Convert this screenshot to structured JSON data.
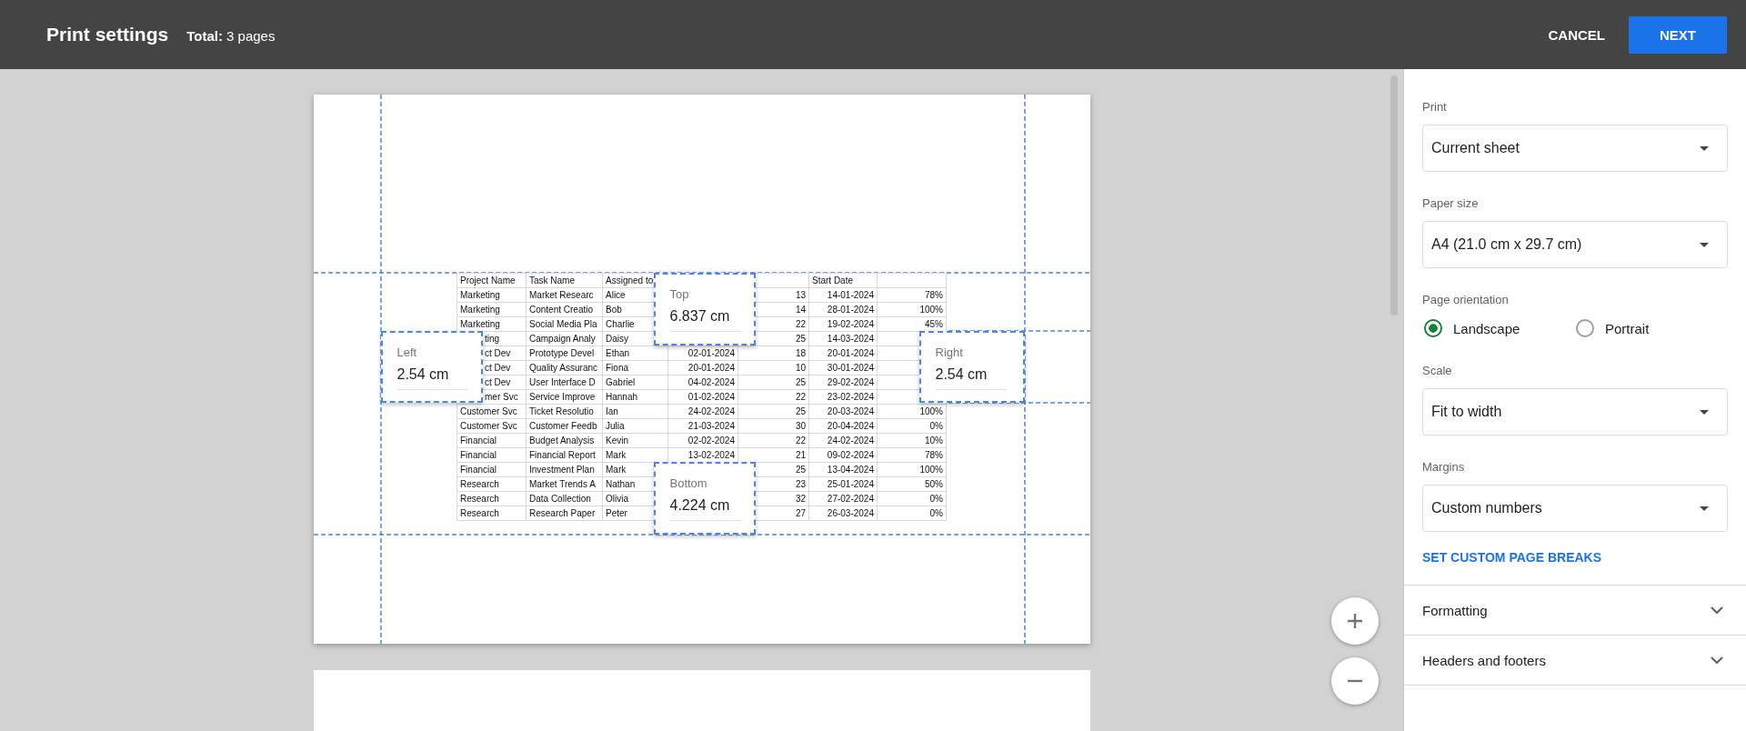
{
  "header": {
    "title": "Print settings",
    "subtitle": "**Total:** 3 pages"
  },
  "actions": [
    {
      "label": "CANCEL",
      "kind": "text"
    },
    {
      "label": "NEXT",
      "kind": "primary"
    }
  ],
  "preview": {
    "pages": [
      {
        "kind": "sheet",
        "table": {
          "header": {
            "column_1": "Project Name",
            "column_2": "Task Name",
            "column_3": "Assigned to",
            "column_6": "Start Date"
          },
          "rows": [
            [
              "Marketing",
              "Market Researc",
              "Alice",
              null,
              "13",
              "14-01-2024",
              "78%"
            ],
            [
              "Marketing",
              "Content Creatio",
              "Bob",
              null,
              "14",
              "28-01-2024",
              "100%"
            ],
            [
              "Marketing",
              "Social Media Pla",
              "Charlie",
              null,
              "22",
              "19-02-2024",
              "45%"
            ],
            [
              "ting",
              "Campaign Analy",
              "Daisy",
              null,
              "25",
              "14-03-2024",
              null
            ],
            [
              "ct Dev",
              "Prototype Devel",
              "Ethan",
              "02-01-2024",
              "18",
              "20-01-2024",
              null
            ],
            [
              "ct Dev",
              "Quality Assuranc",
              "Fiona",
              "20-01-2024",
              "10",
              "30-01-2024",
              null
            ],
            [
              "ct Dev",
              "User Interface D",
              "Gabriel",
              "04-02-2024",
              "25",
              "29-02-2024",
              null
            ],
            [
              "mer Svc",
              "Service Improve",
              "Hannah",
              "01-02-2024",
              "22",
              "23-02-2024",
              null
            ],
            [
              "Customer Svc",
              "Ticket Resolutio",
              "Ian",
              "24-02-2024",
              "25",
              "20-03-2024",
              "100%"
            ],
            [
              "Customer Svc",
              "Customer Feedb",
              "Julia",
              "21-03-2024",
              "30",
              "20-04-2024",
              "0%"
            ],
            [
              "Financial",
              "Budget Analysis",
              "Kevin",
              "02-02-2024",
              "22",
              "24-02-2024",
              "10%"
            ],
            [
              "Financial",
              "Financial Report",
              "Mark",
              "13-02-2024",
              "21",
              "09-02-2024",
              "78%"
            ],
            [
              "Financial",
              "Investment Plan",
              "Mark",
              null,
              "25",
              "13-04-2024",
              "100%"
            ],
            [
              "Research",
              "Market Trends A",
              "Nathan",
              null,
              "23",
              "25-01-2024",
              "50%"
            ],
            [
              "Research",
              "Data Collection",
              "Olivia",
              null,
              "32",
              "27-02-2024",
              "0%"
            ],
            [
              "Research",
              "Research Paper",
              "Peter",
              null,
              "27",
              "26-03-2024",
              "0%"
            ]
          ]
        },
        "margins": [
          {
            "kind": "top",
            "label": "Top",
            "value": "6.837 cm"
          },
          {
            "kind": "left",
            "label": "Left",
            "value": "2.54 cm"
          },
          {
            "kind": "right",
            "label": "Right",
            "value": "2.54 cm"
          },
          {
            "kind": "bottom",
            "label": "Bottom",
            "value": "4.224 cm"
          }
        ]
      },
      {
        "kind": "blank"
      }
    ]
  },
  "settings": [
    {
      "kind": "select",
      "label": "Print",
      "value": "Current sheet"
    },
    {
      "kind": "select",
      "label": "Paper size",
      "value": "A4 (21.0 cm x 29.7 cm)"
    },
    {
      "kind": "radio",
      "label": "Page orientation",
      "options": [
        {
          "label": "Landscape",
          "selected": true
        },
        {
          "label": "Portrait",
          "selected": false
        }
      ]
    },
    {
      "kind": "select",
      "label": "Scale",
      "value": "Fit to width"
    },
    {
      "kind": "select",
      "label": "Margins",
      "value": "Custom numbers"
    },
    {
      "kind": "link",
      "label": "SET CUSTOM PAGE BREAKS"
    }
  ],
  "sections": [
    {
      "label": "Formatting",
      "expanded": false
    },
    {
      "label": "Headers and footers",
      "expanded": false
    }
  ]
}
